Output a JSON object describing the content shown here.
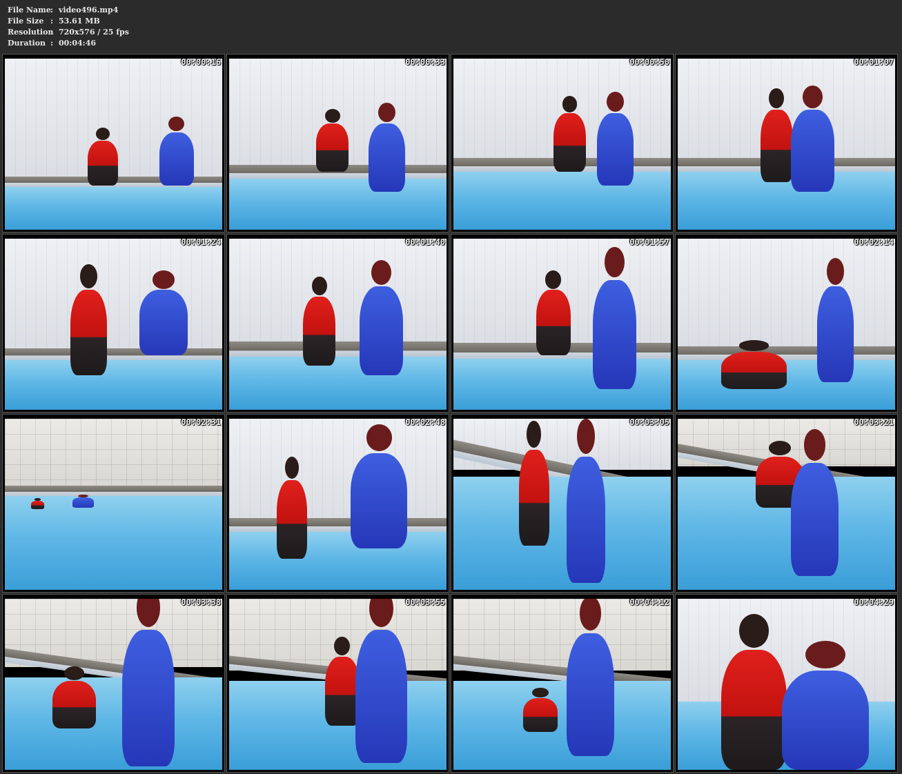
{
  "file_info": [
    {
      "label": "File Name",
      "value": "video496.mp4"
    },
    {
      "label": "File Size",
      "value": "53.61 MB"
    },
    {
      "label": "Resolution",
      "value": "720x576 / 25 fps"
    },
    {
      "label": "Duration",
      "value": "00:04:46"
    }
  ],
  "separator": ":",
  "thumbnails": [
    {
      "timestamp": "00:00:16"
    },
    {
      "timestamp": "00:00:33"
    },
    {
      "timestamp": "00:00:50"
    },
    {
      "timestamp": "00:01:07"
    },
    {
      "timestamp": "00:01:24"
    },
    {
      "timestamp": "00:01:40"
    },
    {
      "timestamp": "00:01:57"
    },
    {
      "timestamp": "00:02:14"
    },
    {
      "timestamp": "00:02:31"
    },
    {
      "timestamp": "00:02:48"
    },
    {
      "timestamp": "00:03:05"
    },
    {
      "timestamp": "00:03:21"
    },
    {
      "timestamp": "00:03:38"
    },
    {
      "timestamp": "00:03:55"
    },
    {
      "timestamp": "00:04:12"
    },
    {
      "timestamp": "00:04:29"
    }
  ],
  "colors": {
    "background": "#2b2b2b",
    "header_text": "#e6e6e6",
    "water": "#5fb7e6",
    "red_suit": "#d41a16",
    "blue_suit": "#2f45c8"
  }
}
